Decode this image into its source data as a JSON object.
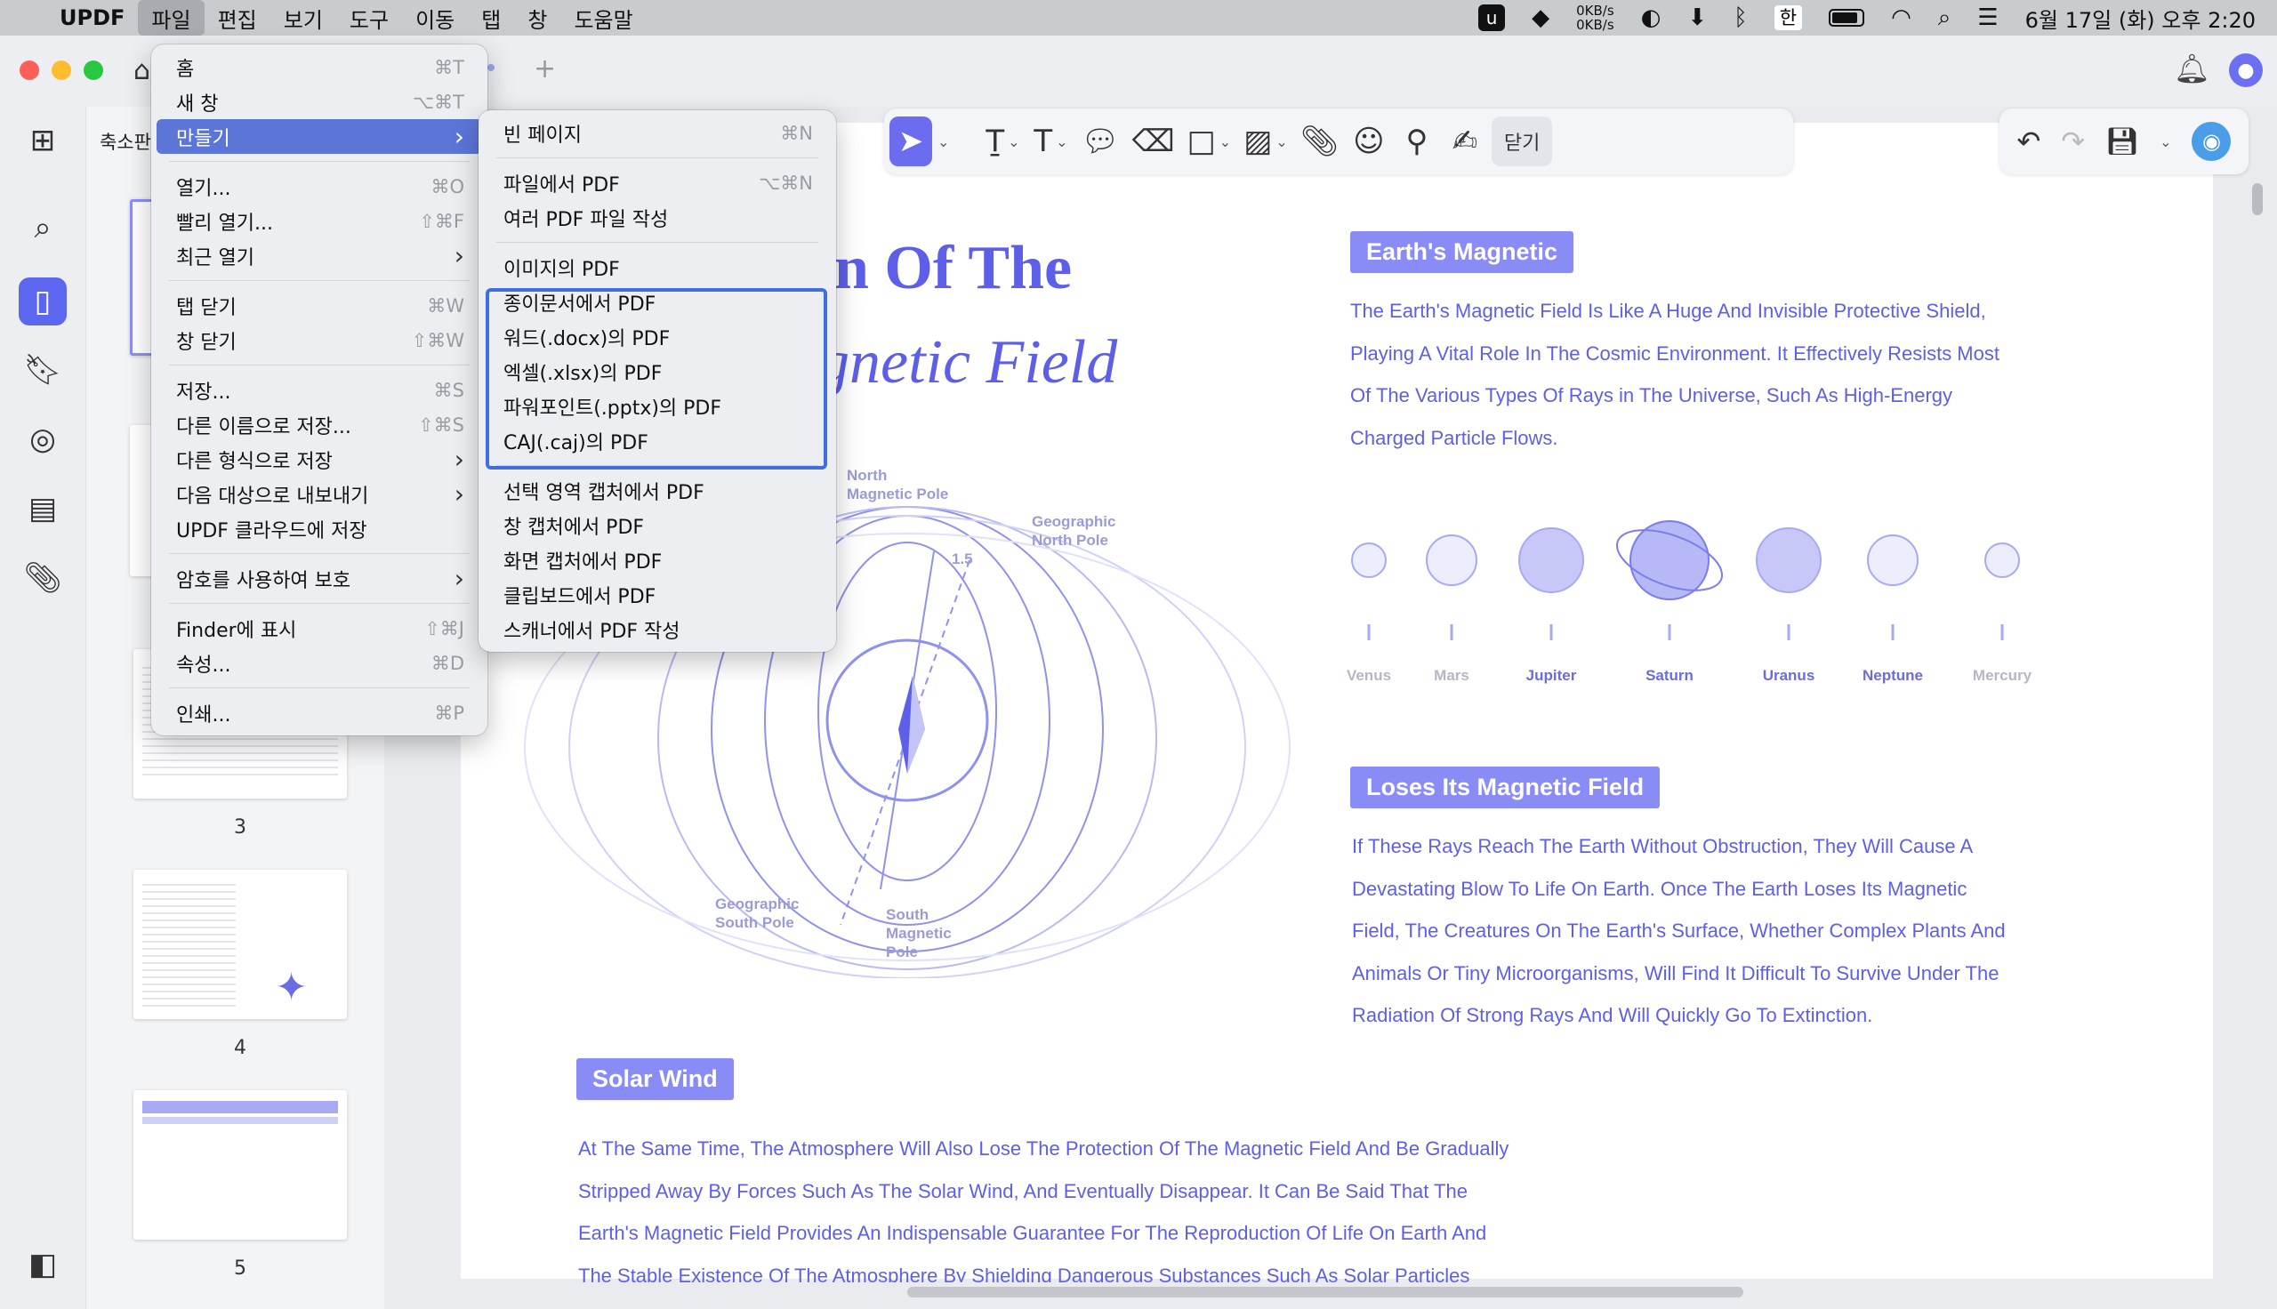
{
  "menubar": {
    "app": "UPDF",
    "items": [
      "파일",
      "편집",
      "보기",
      "도구",
      "이동",
      "탭",
      "창",
      "도움말"
    ],
    "net_up": "0KB/s",
    "net_down": "0KB/s",
    "input": "한",
    "datetime": "6월 17일 (화) 오후 2:20"
  },
  "sidebar": {
    "thumb_header": "축소판",
    "page_numbers": [
      "3",
      "4",
      "5"
    ]
  },
  "toolbar": {
    "close_label": "닫기"
  },
  "file_menu": {
    "items": [
      {
        "label": "홈",
        "shortcut": "⌘T"
      },
      {
        "label": "새 창",
        "shortcut": "⌥⌘T"
      },
      {
        "label": "만들기",
        "shortcut": "›"
      },
      {
        "label": "열기...",
        "shortcut": "⌘O"
      },
      {
        "label": "빨리 열기...",
        "shortcut": "⇧⌘F"
      },
      {
        "label": "최근 열기",
        "shortcut": "›"
      },
      {
        "label": "탭 닫기",
        "shortcut": "⌘W"
      },
      {
        "label": "창 닫기",
        "shortcut": "⇧⌘W"
      },
      {
        "label": "저장...",
        "shortcut": "⌘S"
      },
      {
        "label": "다른 이름으로 저장...",
        "shortcut": "⇧⌘S"
      },
      {
        "label": "다른 형식으로 저장",
        "shortcut": "›"
      },
      {
        "label": "다음 대상으로 내보내기",
        "shortcut": "›"
      },
      {
        "label": "UPDF 클라우드에 저장",
        "shortcut": ""
      },
      {
        "label": "암호를 사용하여 보호",
        "shortcut": "›"
      },
      {
        "label": "Finder에 표시",
        "shortcut": "⇧⌘J"
      },
      {
        "label": "속성...",
        "shortcut": "⌘D"
      },
      {
        "label": "인쇄...",
        "shortcut": "⌘P"
      }
    ]
  },
  "create_menu": {
    "items": [
      {
        "label": "빈 페이지",
        "shortcut": "⌘N"
      },
      {
        "label": "파일에서 PDF",
        "shortcut": "⌥⌘N"
      },
      {
        "label": "여러 PDF 파일 작성",
        "shortcut": ""
      },
      {
        "label": "이미지의 PDF",
        "shortcut": ""
      },
      {
        "label": "종이문서에서 PDF",
        "shortcut": ""
      },
      {
        "label": "워드(.docx)의 PDF",
        "shortcut": ""
      },
      {
        "label": "엑셀(.xlsx)의 PDF",
        "shortcut": ""
      },
      {
        "label": "파워포인트(.pptx)의 PDF",
        "shortcut": ""
      },
      {
        "label": "CAJ(.caj)의 PDF",
        "shortcut": ""
      },
      {
        "label": "선택 영역 캡처에서 PDF",
        "shortcut": ""
      },
      {
        "label": "창 캡처에서 PDF",
        "shortcut": ""
      },
      {
        "label": "화면 캡처에서 PDF",
        "shortcut": ""
      },
      {
        "label": "클립보드에서 PDF",
        "shortcut": ""
      },
      {
        "label": "스캐너에서 PDF 작성",
        "shortcut": ""
      }
    ]
  },
  "document": {
    "title_line1": "n Of The",
    "title_line2": "gnetic Field",
    "earth_tag": "Earth's Magnetic",
    "earth_lines": [
      "The Earth's Magnetic Field Is Like A Huge And Invisible Protective Shield,",
      "Playing A Vital Role In The Cosmic Environment. It Effectively Resists Most",
      "Of The Various Types Of Rays in The Universe, Such As High-Energy",
      "Charged Particle Flows."
    ],
    "planets": [
      "Venus",
      "Mars",
      "Jupiter",
      "Saturn",
      "Uranus",
      "Neptune",
      "Mercury"
    ],
    "loses_tag": "Loses Its Magnetic Field",
    "loses_lines": [
      "If These Rays Reach The Earth Without Obstruction, They Will Cause A",
      "Devastating Blow To Life On Earth. Once The Earth Loses Its Magnetic",
      "Field, The Creatures On The Earth's Surface, Whether Complex Plants And",
      "Animals Or Tiny Microorganisms, Will Find It Difficult To Survive Under The",
      "Radiation Of Strong Rays And Will Quickly Go To Extinction."
    ],
    "solar_tag": "Solar Wind",
    "solar_lines": [
      "At The Same Time, The Atmosphere Will Also Lose The Protection Of The Magnetic Field And Be Gradually",
      "Stripped Away By Forces Such As The Solar Wind, And Eventually Disappear. It Can Be Said That The",
      "Earth's Magnetic Field Provides An Indispensable Guarantee For The Reproduction Of Life On Earth And",
      "The Stable Existence Of The Atmosphere By Shielding Dangerous Substances Such As Solar Particles"
    ],
    "diagram": {
      "north_magnetic": "North\nMagnetic Pole",
      "north_geo": "Geographic\nNorth Pole",
      "angle": "1.5",
      "south_geo": "Geographic\nSouth Pole",
      "south_magnetic": "South\nMagnetic\nPole"
    }
  }
}
